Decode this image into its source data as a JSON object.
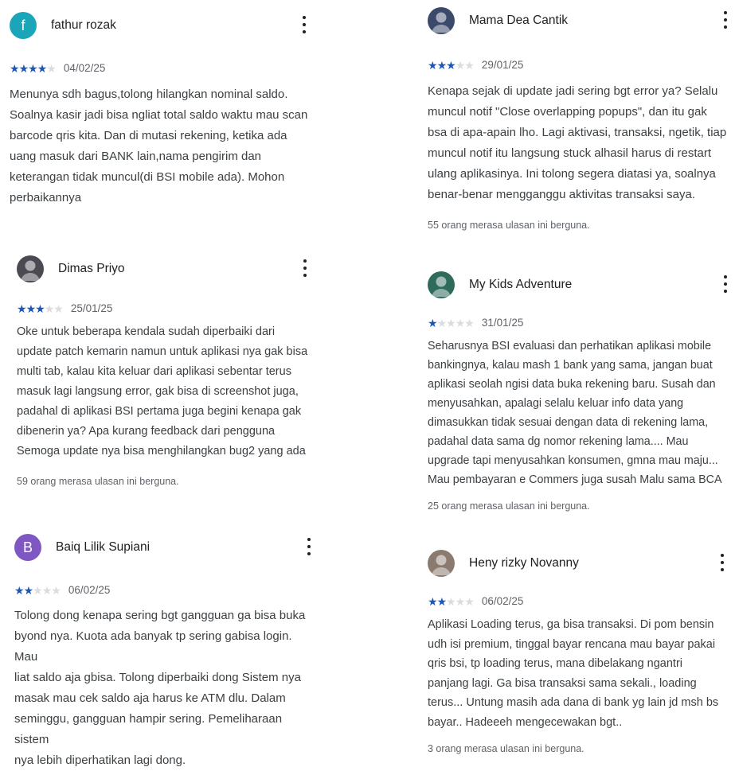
{
  "colors": {
    "star_on": "#1a57b9",
    "star_off": "#dadce0",
    "text": "#3c4043",
    "meta": "#5f6368"
  },
  "reviews": [
    {
      "name": "fathur rozak",
      "avatar": {
        "type": "letter",
        "letter": "f",
        "color": "#1aa5b8"
      },
      "rating": 4,
      "date": "04/02/25",
      "lines": [
        "Menunya sdh bagus,tolong hilangkan nominal saldo.",
        "Soalnya kasir jadi bisa ngliat total saldo waktu mau scan",
        "barcode qris kita. Dan di mutasi rekening, ketika ada",
        "uang masuk dari BANK lain,nama pengirim dan",
        "keterangan tidak muncul(di BSI mobile ada). Mohon",
        "perbaikannya"
      ],
      "helpful": ""
    },
    {
      "name": "Dimas Priyo",
      "avatar": {
        "type": "photo",
        "icon": "person-photo-icon",
        "color": "#4a4a52"
      },
      "rating": 3,
      "date": "25/01/25",
      "lines": [
        "Oke untuk beberapa kendala sudah diperbaiki dari",
        "update patch kemarin namun untuk aplikasi nya gak bisa",
        "multi tab, kalau kita keluar dari aplikasi sebentar terus",
        "masuk lagi langsung error, gak bisa di screenshot juga,",
        "padahal di aplikasi BSI pertama juga begini kenapa gak",
        "dibenerin ya? Apa kurang feedback dari pengguna",
        "Semoga update nya bisa menghilangkan bug2 yang ada"
      ],
      "helpful": "59 orang merasa ulasan ini berguna."
    },
    {
      "name": "Baiq Lilik Supiani",
      "avatar": {
        "type": "letter",
        "letter": "B",
        "color": "#7e57c2"
      },
      "rating": 2,
      "date": "06/02/25",
      "lines": [
        "Tolong dong kenapa sering bgt gangguan ga bisa buka",
        "byond nya. Kuota ada banyak tp sering gabisa login. Mau",
        "liat saldo aja gbisa. Tolong diperbaiki dong Sistem nya",
        "masak mau cek saldo aja harus ke ATM dlu. Dalam",
        "seminggu, gangguan hampir sering. Pemeliharaan sistem",
        "nya lebih diperhatikan lagi dong."
      ],
      "helpful": ""
    },
    {
      "name": "Mama Dea Cantik",
      "avatar": {
        "type": "photo",
        "icon": "person-photo-icon",
        "color": "#3b4a6b"
      },
      "rating": 3,
      "date": "29/01/25",
      "lines": [
        "Kenapa sejak di update jadi sering bgt error ya? Selalu",
        "muncul notif \"Close overlapping popups\", dan itu gak",
        "bsa di apa-apain lho. Lagi aktivasi, transaksi, ngetik, tiap",
        "muncul notif itu langsung stuck alhasil harus di restart",
        "ulang aplikasinya. Ini tolong segera diatasi ya, soalnya",
        "benar-benar mengganggu aktivitas transaksi saya."
      ],
      "helpful": "55 orang merasa ulasan ini berguna."
    },
    {
      "name": "My Kids Adventure",
      "avatar": {
        "type": "photo",
        "icon": "person-photo-icon",
        "color": "#2f6b5b"
      },
      "rating": 1,
      "date": "31/01/25",
      "lines": [
        "Seharusnya BSI evaluasi dan perhatikan aplikasi mobile",
        "bankingnya, kalau mash 1 bank yang sama, jangan buat",
        "aplikasi seolah ngisi data buka rekening baru. Susah dan",
        "menyusahkan, apalagi selalu keluar info data yang",
        "dimasukkan tidak sesuai dengan data di rekening lama,",
        "padahal data sama dg nomor rekening lama.... Mau",
        "upgrade tapi menyusahkan konsumen, gmna mau maju...",
        "Mau pembayaran e Commers juga susah Malu sama BCA"
      ],
      "helpful": "25 orang merasa ulasan ini berguna."
    },
    {
      "name": "Heny rizky Novanny",
      "avatar": {
        "type": "photo",
        "icon": "person-photo-icon",
        "color": "#8a7a70"
      },
      "rating": 2,
      "date": "06/02/25",
      "lines": [
        "Aplikasi Loading terus, ga bisa transaksi. Di pom bensin",
        "udh isi premium, tinggal bayar rencana mau bayar pakai",
        "qris bsi, tp loading terus, mana dibelakang ngantri",
        "panjang lagi. Ga bisa transaksi sama sekali., loading",
        "terus... Untung masih ada dana di bank yg lain jd msh bs",
        "bayar.. Hadeeeh mengecewakan bgt.."
      ],
      "helpful": "3 orang merasa ulasan ini berguna."
    }
  ]
}
